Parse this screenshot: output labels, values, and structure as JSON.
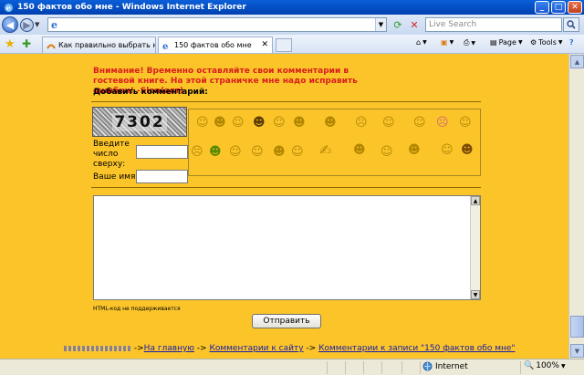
{
  "window": {
    "title": "150 фактов обо мне - Windows Internet Explorer"
  },
  "address": {
    "url": ""
  },
  "search": {
    "placeholder": "Live Search"
  },
  "tabs": [
    {
      "label": "Как правильно выбрать кв..."
    },
    {
      "label": "150 фактов обо мне"
    }
  ],
  "command_bar": {
    "page_label": "Page",
    "tools_label": "Tools"
  },
  "content": {
    "warning": "Внимание! Временно оставляйте свои комментарии в гостевой книге. На этой страничке мне надо исправить ошибки! -Slon(авт)",
    "add_comment_label": "Добавить комментарий:",
    "captcha_text": "7302",
    "captcha_prompt_1": "Введите",
    "captcha_prompt_2": "число",
    "captcha_prompt_3": "сверху:",
    "name_label": "Ваше имя:",
    "html_note": "HTML-код не поддерживается",
    "submit_label": "Отправить"
  },
  "breadcrumbs": {
    "sep": "->",
    "home": "На главную",
    "site_comments": "Комментарии к сайту",
    "post_comments": "Комментарии к записи \"150 фактов обо мне\""
  },
  "statusbar": {
    "zone": "Internet",
    "zoom": "100%"
  },
  "icons": {
    "smileys": [
      "smile-icon",
      "grin-icon",
      "glasses-icon",
      "cool-icon",
      "neutral-icon",
      "evil-icon",
      "devil-icon",
      "sad-icon",
      "laugh-icon",
      "wink-icon",
      "angry-icon",
      "tongue-icon",
      "sick-icon",
      "beer-icon",
      "shock-icon",
      "happy-icon",
      "blush-icon",
      "dance-icon",
      "cowboy-icon",
      "pirate-icon",
      "music-icon",
      "wave-icon",
      "bow-icon",
      "clown-icon"
    ]
  }
}
